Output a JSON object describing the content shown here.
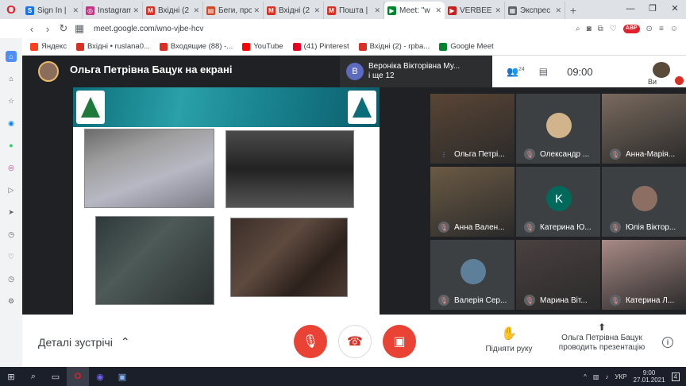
{
  "browser": {
    "tabs": [
      {
        "title": "Sign In |",
        "color": "#1a73e8",
        "glyph": "S"
      },
      {
        "title": "Instagram",
        "color": "#c13584",
        "glyph": "◎"
      },
      {
        "title": "Вхідні (2",
        "color": "#d93025",
        "glyph": "M"
      },
      {
        "title": "Беги, про",
        "color": "#d24726",
        "glyph": "▤"
      },
      {
        "title": "Вхідні (2",
        "color": "#d93025",
        "glyph": "M"
      },
      {
        "title": "Пошта |",
        "color": "#d93025",
        "glyph": "M"
      },
      {
        "title": "Meet: \"w",
        "color": "#00832d",
        "glyph": "▶",
        "active": true
      },
      {
        "title": "VERBEE",
        "color": "#c5221f",
        "glyph": "▶"
      },
      {
        "title": "Экспрес",
        "color": "#5f6368",
        "glyph": "▦"
      }
    ],
    "new_tab": "+",
    "window_buttons": {
      "minimize": "—",
      "restore": "❐",
      "close": "✕"
    },
    "url": "meet.google.com/wno-vjbe-hcv",
    "abp": "ABP",
    "bookmarks": [
      {
        "label": "Яндекс",
        "color": "#fc3f1d"
      },
      {
        "label": "Вхідні • ruslana0...",
        "color": "#d93025"
      },
      {
        "label": "Входящие (88) -...",
        "color": "#d93025"
      },
      {
        "label": "YouTube",
        "color": "#ff0000"
      },
      {
        "label": "(41) Pinterest",
        "color": "#e60023"
      },
      {
        "label": "Вхідні (2) - rpba...",
        "color": "#d93025"
      },
      {
        "label": "Google Meet",
        "color": "#00832d"
      }
    ]
  },
  "meet": {
    "presenter_title": "Ольга Петрівна Бацук на екрані",
    "second_presenter": {
      "initial": "В",
      "line1": "Вероніка Вікторівна Му...",
      "line2": "і ще 12"
    },
    "participants_count": "24",
    "clock": "09:00",
    "self_label": "Ви",
    "participants": [
      {
        "name": "Ольга Петрі...",
        "type": "video",
        "bg": "#5a4535",
        "muted": false
      },
      {
        "name": "Олександр ...",
        "type": "avatar",
        "avatar_bg": "#d2b48c",
        "initial": "",
        "muted": true
      },
      {
        "name": "Анна-Марія...",
        "type": "video",
        "bg": "#7a6a5e",
        "muted": true
      },
      {
        "name": "Анна Вален...",
        "type": "video",
        "bg": "#6b5a44",
        "muted": true
      },
      {
        "name": "Катерина Ю...",
        "type": "avatar",
        "avatar_bg": "#00695c",
        "initial": "K",
        "muted": true
      },
      {
        "name": "Юлія Віктор...",
        "type": "avatar",
        "avatar_bg": "#8d6e63",
        "initial": "",
        "muted": true
      },
      {
        "name": "Валерія Сер...",
        "type": "avatar",
        "avatar_bg": "#5d7f9a",
        "initial": "",
        "muted": true
      },
      {
        "name": "Марина Віт...",
        "type": "video",
        "bg": "#4a4040",
        "muted": true
      },
      {
        "name": "Катерина Л...",
        "type": "video",
        "bg": "#a88a86",
        "muted": true
      }
    ],
    "details_label": "Деталі зустрічі",
    "raise_hand": "Підняти руку",
    "presenting_line1": "Ольга Петрівна Бацук",
    "presenting_line2": "проводить презентацію",
    "colors": {
      "red_button": "#ea4335",
      "accent": "#1a73e8"
    }
  },
  "taskbar": {
    "lang": "УКР",
    "time": "9:00",
    "date": "27.01.2021",
    "notif": "4"
  }
}
